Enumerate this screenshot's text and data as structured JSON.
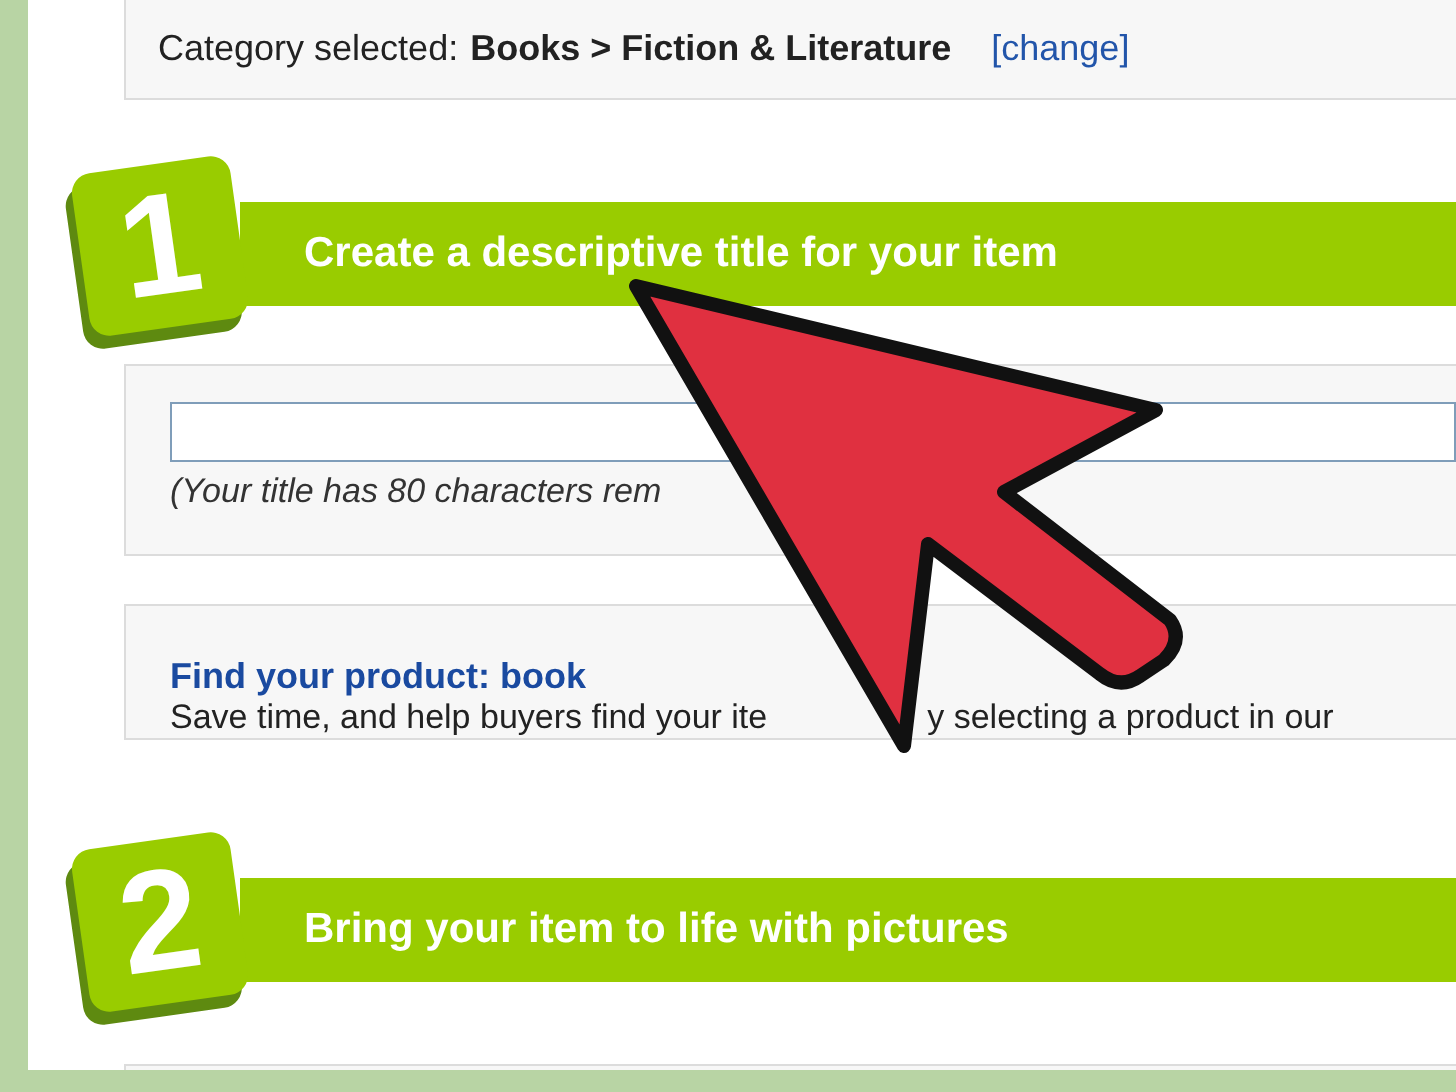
{
  "category": {
    "label": "Category selected:",
    "value": "Books > Fiction & Literature",
    "link": "[change]"
  },
  "steps": [
    {
      "number": "1",
      "title": "Create a descriptive title for your item"
    },
    {
      "number": "2",
      "title": "Bring your item to life with pictures"
    }
  ],
  "title_field": {
    "hint": "(Your title has 80 characters rem"
  },
  "product": {
    "link": "Find your product: book",
    "text_parts": [
      "Save time, and help buyers find your ite",
      "y selecting a product in our"
    ]
  }
}
